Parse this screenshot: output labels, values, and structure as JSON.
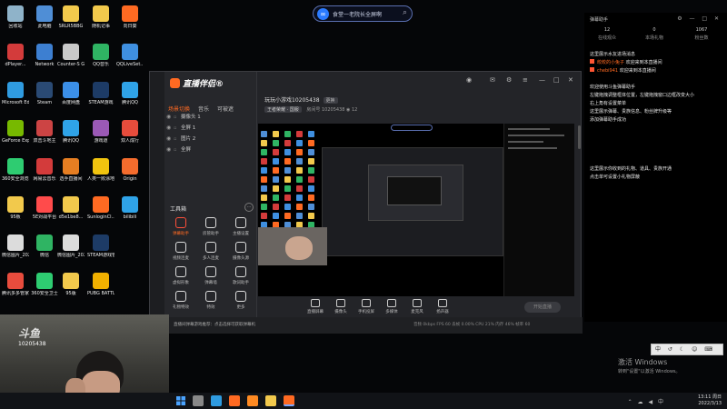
{
  "search": {
    "text": "食堂一老院长全屏啊"
  },
  "desktop_icons": [
    {
      "label": "回收站",
      "color": "#8fb3c9",
      "col": 0,
      "row": 0
    },
    {
      "label": "此电脑",
      "color": "#4f8ed6",
      "col": 1,
      "row": 0
    },
    {
      "label": "SRLR5BBG",
      "color": "#f2c94c",
      "col": 2,
      "row": 0
    },
    {
      "label": "随机记事",
      "color": "#f2c94c",
      "col": 3,
      "row": 0
    },
    {
      "label": "向日葵",
      "color": "#ff6a22",
      "col": 4,
      "row": 0
    },
    {
      "label": "dPlayer...",
      "color": "#d33b3b",
      "col": 0,
      "row": 1
    },
    {
      "label": "Network",
      "color": "#3d7fd1",
      "col": 1,
      "row": 1
    },
    {
      "label": "Counter-S Global Offe...",
      "color": "#c9c9c9",
      "col": 2,
      "row": 1
    },
    {
      "label": "QQ音乐",
      "color": "#2fb463",
      "col": 3,
      "row": 1
    },
    {
      "label": "QQLiveSet...",
      "color": "#3f8fe0",
      "col": 4,
      "row": 1
    },
    {
      "label": "Microsoft Edge",
      "color": "#2f9be0",
      "col": 0,
      "row": 2
    },
    {
      "label": "Steam",
      "color": "#2a4a74",
      "col": 1,
      "row": 2
    },
    {
      "label": "百度网盘",
      "color": "#3b8fe8",
      "col": 2,
      "row": 2
    },
    {
      "label": "STEAM游戏",
      "color": "#1d3b66",
      "col": 3,
      "row": 2
    },
    {
      "label": "腾讯QQ",
      "color": "#2fa3e8",
      "col": 4,
      "row": 2
    },
    {
      "label": "GeForce Experience",
      "color": "#77b900",
      "col": 0,
      "row": 3
    },
    {
      "label": "双击斗地主",
      "color": "#c44",
      "col": 1,
      "row": 3
    },
    {
      "label": "腾讯QQ",
      "color": "#2fa3e8",
      "col": 2,
      "row": 3
    },
    {
      "label": "游戏道",
      "color": "#9b59b6",
      "col": 3,
      "row": 3
    },
    {
      "label": "双人成行",
      "color": "#e74c3c",
      "col": 4,
      "row": 3
    },
    {
      "label": "360安全浏览器",
      "color": "#2ecc71",
      "col": 0,
      "row": 4
    },
    {
      "label": "网易云音乐",
      "color": "#d33b3b",
      "col": 1,
      "row": 4
    },
    {
      "label": "选手直播间",
      "color": "#e67e22",
      "col": 2,
      "row": 4
    },
    {
      "label": "人类一败涂地 Human Fa...",
      "color": "#f1c40f",
      "col": 3,
      "row": 4
    },
    {
      "label": "Origin",
      "color": "#f56c2d",
      "col": 4,
      "row": 4
    },
    {
      "label": "95板",
      "color": "#f2c94c",
      "col": 0,
      "row": 5
    },
    {
      "label": "5E对战平台",
      "color": "#ff4b4b",
      "col": 1,
      "row": 5
    },
    {
      "label": "d5e1be8...",
      "color": "#f2c94c",
      "col": 2,
      "row": 5
    },
    {
      "label": "SunloginCl...",
      "color": "#ff6a22",
      "col": 3,
      "row": 5
    },
    {
      "label": "bilibili",
      "color": "#2fa3e8",
      "col": 4,
      "row": 5
    },
    {
      "label": "微信图片_2021102...",
      "color": "#dcdcdc",
      "col": 0,
      "row": 6
    },
    {
      "label": "微信",
      "color": "#2fb463",
      "col": 1,
      "row": 6
    },
    {
      "label": "微信图片_202109...",
      "color": "#dcdcdc",
      "col": 2,
      "row": 6
    },
    {
      "label": "STEAM游戏管家",
      "color": "#1d3b66",
      "col": 3,
      "row": 6
    },
    {
      "label": "腾讯多多管家",
      "color": "#e84c3d",
      "col": 0,
      "row": 7
    },
    {
      "label": "360安全卫士",
      "color": "#2ecc71",
      "col": 1,
      "row": 7
    },
    {
      "label": "95版",
      "color": "#f2c94c",
      "col": 2,
      "row": 7
    },
    {
      "label": "PUBG BATTLEGR...",
      "color": "#f1b000",
      "col": 3,
      "row": 7
    }
  ],
  "app": {
    "logo": "直播伴侣",
    "logo_tag": "®",
    "tabs": [
      "场景切换",
      "音乐",
      "节奏",
      "可被遮"
    ],
    "scenes": [
      "摄像头 1",
      "全屏 1",
      "图片 2",
      "全屏"
    ],
    "tools_title": "工具箱",
    "tools": [
      {
        "label": "弹幕助手",
        "hot": true
      },
      {
        "label": "房管助手",
        "hot": false
      },
      {
        "label": "主播设置",
        "hot": false
      },
      {
        "label": "视频连麦",
        "hot": false
      },
      {
        "label": "多人连麦",
        "hot": false
      },
      {
        "label": "摄像头源",
        "hot": false
      },
      {
        "label": "虚拟形象",
        "hot": false
      },
      {
        "label": "弹幕墙",
        "hot": false
      },
      {
        "label": "歌词助手",
        "hot": false
      },
      {
        "label": "礼物特效",
        "hot": false
      },
      {
        "label": "特效",
        "hot": false
      },
      {
        "label": "更多",
        "hot": false
      }
    ],
    "room_title": "玩玩小游戏10205438",
    "room_badge": "更换",
    "room_category": "王者荣耀 · 国服",
    "room_id": "10205438",
    "room_viewers": "12",
    "bottom_items": [
      "直播屏幕",
      "摄像头",
      "手机投屏",
      "多媒体",
      "麦克风",
      "扬声器"
    ],
    "start_label": "开始直播",
    "notice": "直播间弹幕游戏推荐：点击选择可获取弹幕机",
    "stats": "音频 0kbps   FPS 60   丢帧 0.00%   CPU 21%   内存 46%   帧率 60"
  },
  "chat_panel": {
    "title": "弹幕助手",
    "icons": "⚙ — □ ✕",
    "stats": [
      {
        "value": "12",
        "label": "在线观众"
      },
      {
        "value": "0",
        "label": "本场礼物"
      },
      {
        "value": "1067",
        "label": "粉丝数"
      }
    ],
    "messages": [
      {
        "user": "",
        "text": "这里展示水友进场消息"
      },
      {
        "user": "皎皎的小兔子",
        "text": "欢迎来到本直播间",
        "badge": true
      },
      {
        "user": "chebi941",
        "text": "欢迎来到本直播间",
        "badge": true
      },
      {
        "user": "",
        "text": ""
      },
      {
        "user": "",
        "text": "欢迎使用斗鱼弹幕助手"
      },
      {
        "user": "",
        "text": "左键拖拽调整框体位置，左键拖拽窗口边框改变大小"
      },
      {
        "user": "",
        "text": "右上角有设置菜单"
      },
      {
        "user": "",
        "text": "这里展示弹幕、贵族信息、粉丝牌升级等"
      },
      {
        "user": "",
        "text": "添加弹幕助手成功"
      },
      {
        "user": "",
        "text": ""
      },
      {
        "user": "",
        "text": ""
      },
      {
        "user": "",
        "text": ""
      },
      {
        "user": "",
        "text": ""
      },
      {
        "user": "",
        "text": ""
      },
      {
        "user": "",
        "text": "这里展示你收到的礼物、道具、贵族开通"
      },
      {
        "user": "",
        "text": "点击单可设置小礼物屏蔽"
      }
    ]
  },
  "watermark": {
    "logo": "斗鱼",
    "room": "10205438"
  },
  "activate": {
    "title": "激活 Windows",
    "sub": "转到\"设置\"以激活 Windows。"
  },
  "ime": {
    "text": "中 ↺ ☾ ☺ ⌨"
  },
  "tray": {
    "time": "13:11 周日",
    "date": "2022/3/13"
  },
  "taskbar_apps": [
    {
      "name": "search",
      "color": "#888"
    },
    {
      "name": "edge",
      "color": "#2f9be0"
    },
    {
      "name": "sunlogin",
      "color": "#ff6a22"
    },
    {
      "name": "douyu",
      "color": "#ff8a22"
    },
    {
      "name": "folder",
      "color": "#f2c94c"
    },
    {
      "name": "live-companion",
      "color": "#ff6a22"
    }
  ]
}
